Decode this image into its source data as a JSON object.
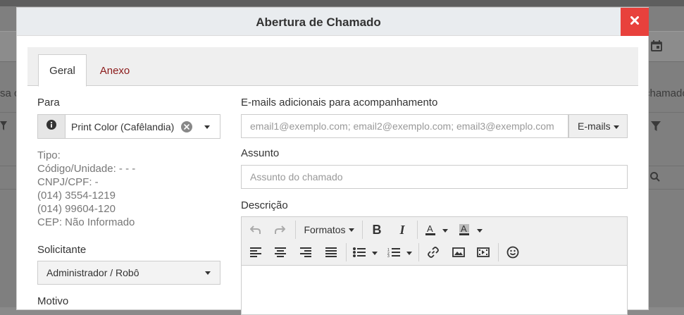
{
  "modal": {
    "title": "Abertura de Chamado"
  },
  "tabs": [
    {
      "label": "Geral"
    },
    {
      "label": "Anexo"
    }
  ],
  "left": {
    "para_label": "Para",
    "para_value": "Print Color (Cafêlandia)",
    "info_lines": [
      "Tipo:",
      "Código/Unidade: - - -",
      "CNPJ/CPF: -",
      "(014) 3554-1219",
      "(014) 99604-120",
      "CEP: Não Informado"
    ],
    "solicitante_label": "Solicitante",
    "solicitante_value": "Administrador / Robô",
    "motivo_label": "Motivo"
  },
  "right": {
    "emails_label": "E-mails adicionais para acompanhamento",
    "emails_placeholder": "email1@exemplo.com; email2@exemplo.com; email3@exemplo.com",
    "emails_button": "E-mails",
    "assunto_label": "Assunto",
    "assunto_placeholder": "Assunto do chamado",
    "descricao_label": "Descrição",
    "formats_label": "Formatos"
  },
  "backdrop": {
    "left_text": "sa c",
    "right_text": "chamado"
  },
  "colors": {
    "close_bg": "#e8413c",
    "active_tab_text": "#333333",
    "inactive_tab_text": "#8b1a1a"
  }
}
